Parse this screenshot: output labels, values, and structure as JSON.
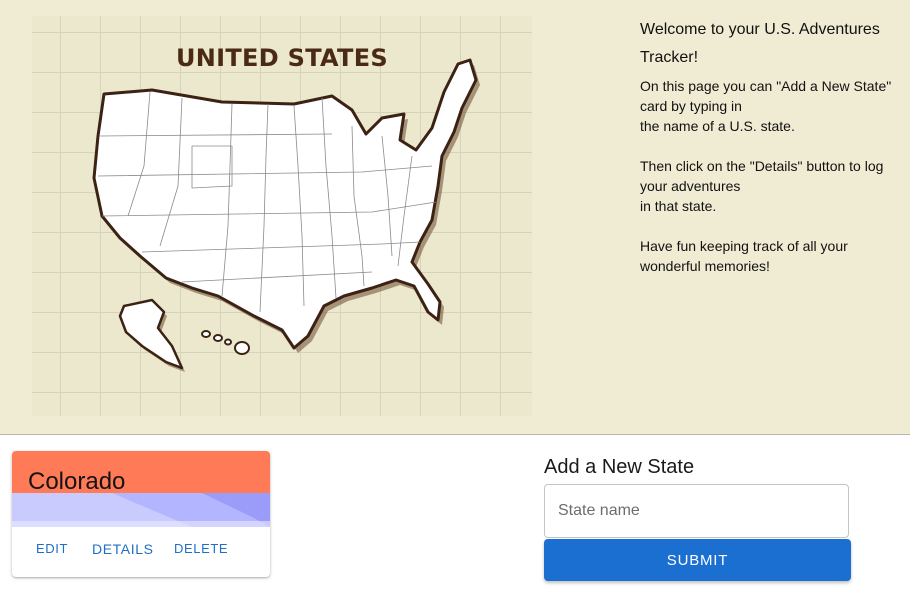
{
  "map": {
    "title": "UNITED STATES"
  },
  "intro": {
    "title": "Welcome to your U.S. Adventures Tracker!",
    "p1_lines": [
      "On this page you can \"Add a New State\" card by typing in",
      "the name of a U.S. state."
    ],
    "p2_lines": [
      "Then click on the \"Details\" button to log your adventures",
      "in that state."
    ],
    "p3_lines": [
      "Have fun keeping track of all your wonderful memories!"
    ]
  },
  "cards": [
    {
      "title": "Colorado",
      "edit_label": "EDIT",
      "details_label": "DETAILS",
      "delete_label": "DELETE"
    }
  ],
  "add_state": {
    "title": "Add a New State",
    "input_placeholder": "State name",
    "input_value": "",
    "submit_label": "SUBMIT"
  },
  "colors": {
    "hero_bg": "#f0ecd4",
    "card_header": "#ff7b57",
    "card_wave_light": "#c9cbff",
    "card_wave_dark": "#9b9cfa",
    "accent_blue": "#1a6fd1",
    "link_blue": "#1e6fc6",
    "map_outline": "#4a2a17"
  }
}
